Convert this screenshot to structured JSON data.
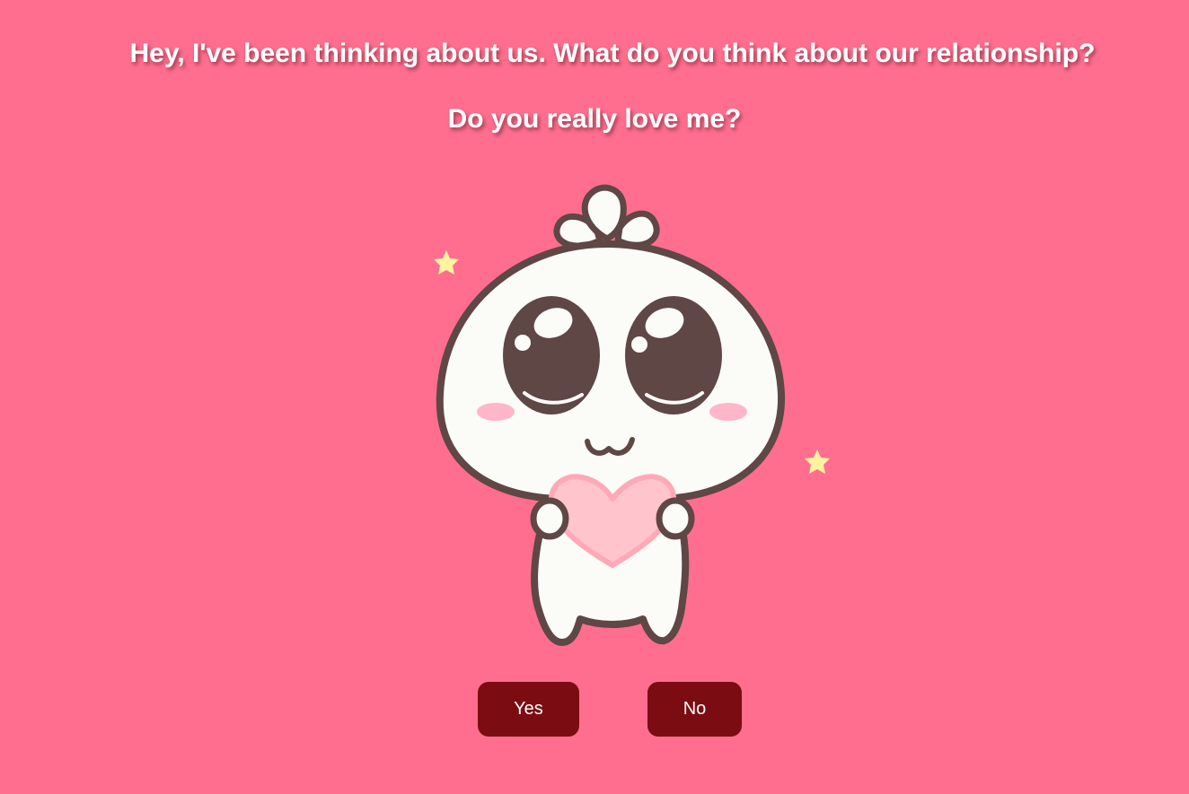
{
  "prompt": {
    "line1": "Hey, I've been thinking about us. What do you think about our relationship?",
    "line2": "Do you really love me?"
  },
  "illustration": {
    "name": "cute-mascot-holding-heart",
    "colors": {
      "outline": "#5e4745",
      "body": "#fbfbf8",
      "heart": "#ffc4cc",
      "blush": "#ffb6c8",
      "stars": "#fff3a0"
    }
  },
  "buttons": {
    "yes_label": "Yes",
    "no_label": "No"
  },
  "theme": {
    "background": "#ff6e8e",
    "button_bg": "#7b0d12",
    "text": "#ffffff"
  }
}
